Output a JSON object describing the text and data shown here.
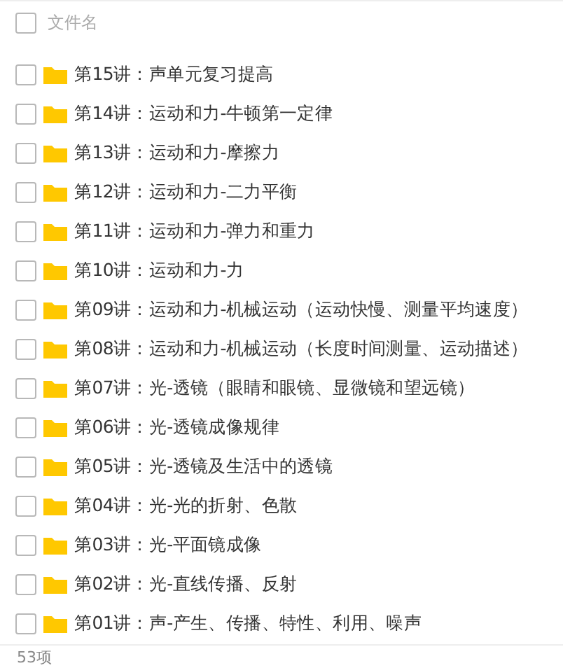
{
  "header": {
    "checked": false,
    "label": "文件名"
  },
  "files": [
    {
      "name": "第15讲：声单元复习提高",
      "checked": false
    },
    {
      "name": "第14讲：运动和力-牛顿第一定律",
      "checked": false
    },
    {
      "name": "第13讲：运动和力-摩擦力",
      "checked": false
    },
    {
      "name": "第12讲：运动和力-二力平衡",
      "checked": false
    },
    {
      "name": "第11讲：运动和力-弹力和重力",
      "checked": false
    },
    {
      "name": "第10讲：运动和力-力",
      "checked": false
    },
    {
      "name": "第09讲：运动和力-机械运动（运动快慢、测量平均速度）",
      "checked": false
    },
    {
      "name": "第08讲：运动和力-机械运动（长度时间测量、运动描述）",
      "checked": false
    },
    {
      "name": "第07讲：光-透镜（眼睛和眼镜、显微镜和望远镜）",
      "checked": false
    },
    {
      "name": "第06讲：光-透镜成像规律",
      "checked": false
    },
    {
      "name": "第05讲：光-透镜及生活中的透镜",
      "checked": false
    },
    {
      "name": "第04讲：光-光的折射、色散",
      "checked": false
    },
    {
      "name": "第03讲：光-平面镜成像",
      "checked": false
    },
    {
      "name": "第02讲：光-直线传播、反射",
      "checked": false
    },
    {
      "name": "第01讲：声-产生、传播、特性、利用、噪声",
      "checked": false
    }
  ],
  "footer": "53项"
}
